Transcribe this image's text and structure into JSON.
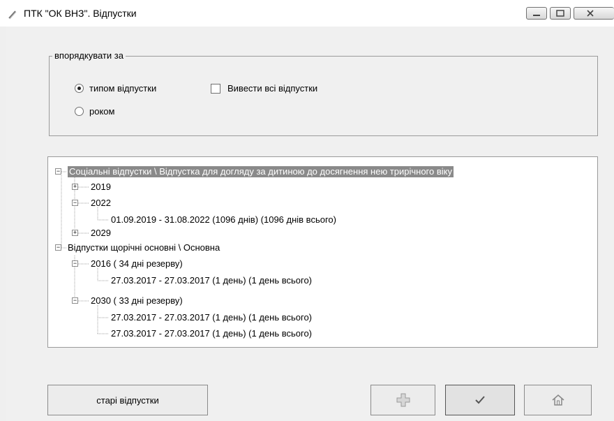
{
  "window": {
    "title": "ПТК \"ОК ВНЗ\". Відпустки"
  },
  "sort_group": {
    "legend": "впорядкувати за",
    "radio_type_label": "типом відпустки",
    "radio_year_label": "роком",
    "radio_type_checked": true,
    "show_all_label": "Вивести всі відпустки",
    "show_all_checked": false
  },
  "tree": {
    "nodes": [
      {
        "label": "Соціальні відпустки \\ Відпустка для догляду за дитиною до досягнення нею трирічного віку"
      },
      {
        "label": "2019"
      },
      {
        "label": "2022"
      },
      {
        "label": "01.09.2019 - 31.08.2022 (1096 днів) (1096 днів всього)"
      },
      {
        "label": "2029"
      },
      {
        "label": "Відпустки щорічні основні \\ Основна"
      },
      {
        "label": "2016 ( 34 дні резерву)"
      },
      {
        "label": "27.03.2017 - 27.03.2017 (1 день) (1 день всього)"
      },
      {
        "label": "2030 ( 33 дні резерву)"
      },
      {
        "label": "27.03.2017 - 27.03.2017 (1 день) (1 день всього)"
      },
      {
        "label": "27.03.2017 - 27.03.2017 (1 день) (1 день всього)"
      }
    ]
  },
  "buttons": {
    "old_leaves_label": "старі відпустки",
    "add_icon": "plus-icon",
    "ok_icon": "checkmark-icon",
    "home_icon": "home-icon"
  },
  "icons": {
    "app": "app-icon",
    "minimize": "minimize-icon",
    "maximize": "maximize-icon",
    "close": "close-icon"
  }
}
